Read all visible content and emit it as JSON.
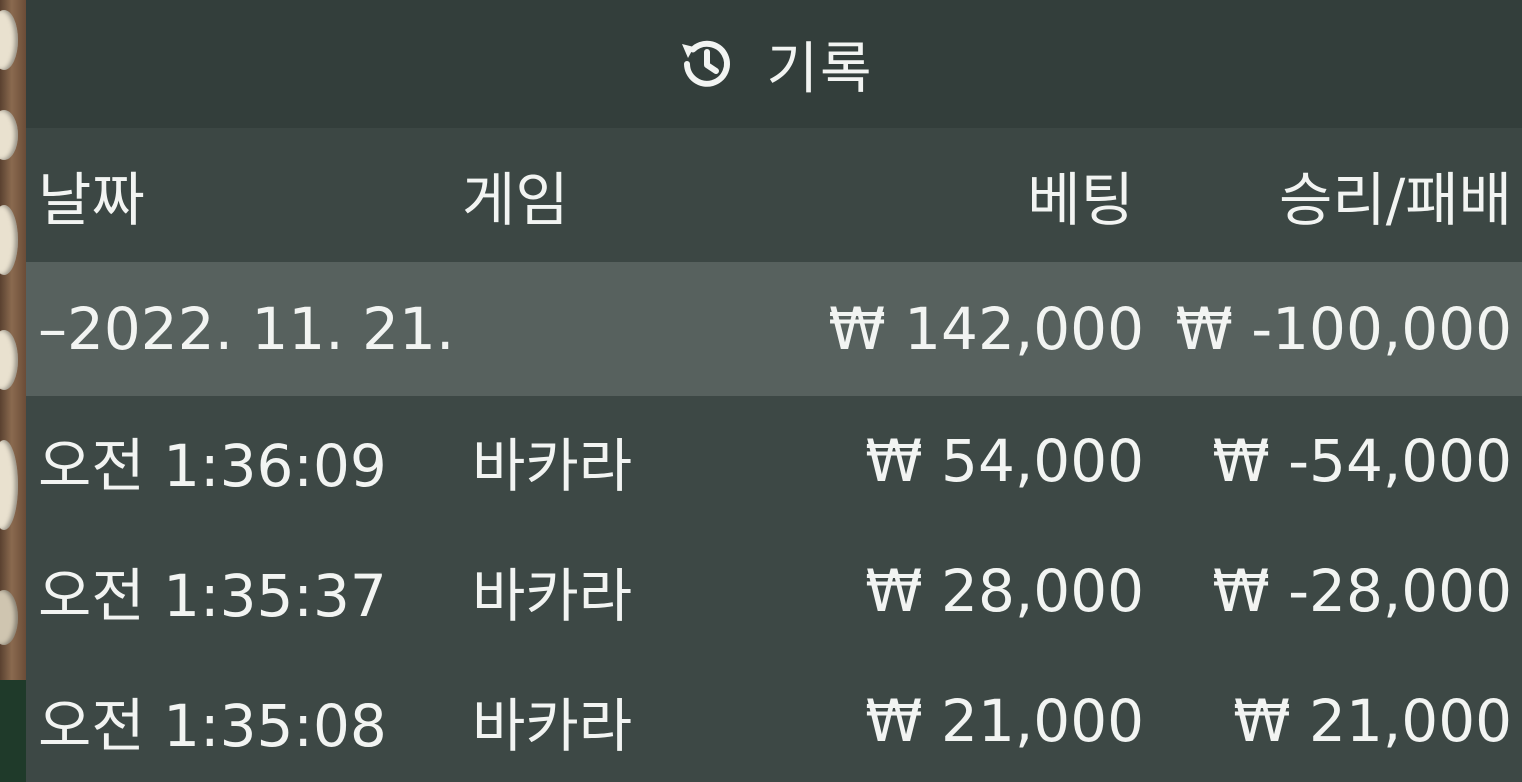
{
  "header": {
    "title": "기록",
    "icon": "history-icon"
  },
  "columns": {
    "date": "날짜",
    "game": "게임",
    "bet": "베팅",
    "result": "승리/패배"
  },
  "group": {
    "date": "–2022. 11. 21.",
    "bet_total": "₩ 142,000",
    "result_total": "₩ -100,000"
  },
  "rows": [
    {
      "time": "오전 1:36:09",
      "game": "바카라",
      "bet": "₩ 54,000",
      "result": "₩ -54,000"
    },
    {
      "time": "오전 1:35:37",
      "game": "바카라",
      "bet": "₩ 28,000",
      "result": "₩ -28,000"
    },
    {
      "time": "오전 1:35:08",
      "game": "바카라",
      "bet": "₩ 21,000",
      "result": "₩ 21,000"
    }
  ],
  "colors": {
    "panel": "#3d4845",
    "header": "#333e3b",
    "group_row": "#57615e",
    "text": "#f2f4f2"
  }
}
